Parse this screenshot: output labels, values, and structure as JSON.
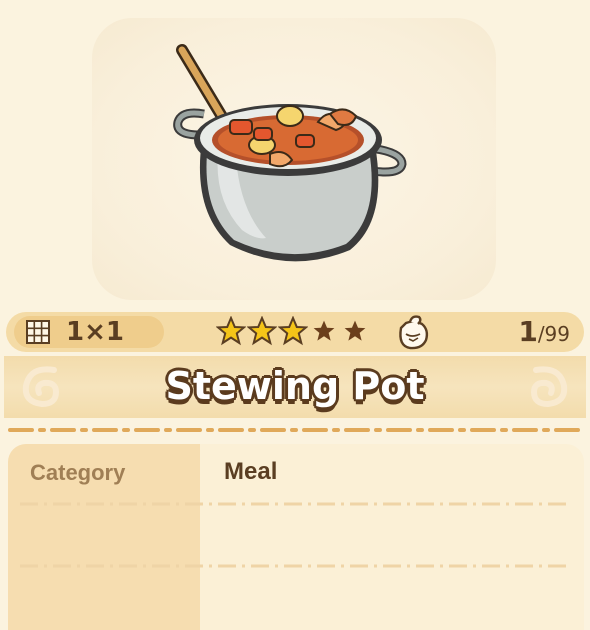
{
  "item": {
    "name": "Stewing Pot",
    "image": "stewing-pot-icon",
    "size": "1×1",
    "rarity_stars_filled": 3,
    "rarity_stars_total": 5,
    "owned_count": "1",
    "max_count": "/99"
  },
  "details": {
    "rows": [
      {
        "label": "Category",
        "value": "Meal"
      },
      {
        "label": "",
        "value": ""
      },
      {
        "label": "",
        "value": ""
      }
    ]
  },
  "colors": {
    "background": "#fbf3df",
    "bar": "#f4dba6",
    "text_dark": "#5a3e22",
    "label_text": "#a07f55",
    "star_filled": "#f5c518",
    "star_empty": "#6b3f1c"
  },
  "icons": [
    "grid-size-icon",
    "star-icon",
    "bag-icon",
    "swirl-ornament-icon"
  ]
}
